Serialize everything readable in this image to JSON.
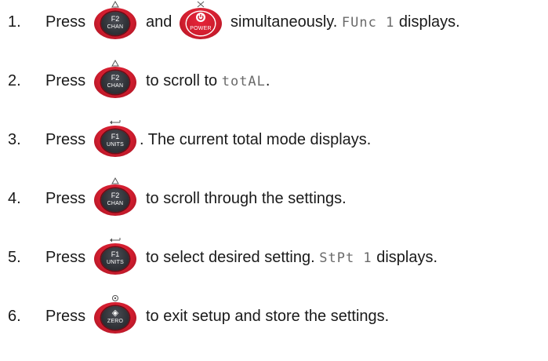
{
  "steps": [
    {
      "num": "1.",
      "press": "Press",
      "key1": {
        "top": "F2",
        "bottom": "CHAN",
        "above": "△"
      },
      "mid": "and",
      "key2": {
        "bottom": "POWER",
        "above": "X"
      },
      "text_a": "simultaneously.",
      "display": "FUnc 1",
      "text_b": "displays."
    },
    {
      "num": "2.",
      "press": "Press",
      "key": {
        "top": "F2",
        "bottom": "CHAN",
        "above": "△"
      },
      "text_a": "to scroll to",
      "display": "totAL",
      "text_b": "."
    },
    {
      "num": "3.",
      "press": "Press",
      "key": {
        "top": "F1",
        "bottom": "UNITS",
        "above": "↩"
      },
      "text_a": ". The current total mode displays."
    },
    {
      "num": "4.",
      "press": "Press",
      "key": {
        "top": "F2",
        "bottom": "CHAN",
        "above": "△"
      },
      "text_a": "to scroll through the settings."
    },
    {
      "num": "5.",
      "press": "Press",
      "key": {
        "top": "F1",
        "bottom": "UNITS",
        "above": "↩"
      },
      "text_a": "to select desired setting.",
      "display": "StPt 1",
      "text_b": "displays."
    },
    {
      "num": "6.",
      "press": "Press",
      "key": {
        "top": "◈",
        "bottom": "ZERO",
        "above": "⊙"
      },
      "text_a": "to exit setup and store the settings."
    }
  ],
  "colors": {
    "key_red": "#d01d2e",
    "key_dark": "#2c2e33",
    "text": "#1a1a1a",
    "segment": "#6a6a6a"
  }
}
